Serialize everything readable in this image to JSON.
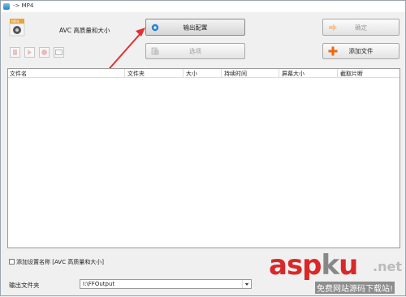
{
  "window": {
    "title": "-> MP4"
  },
  "profile": {
    "label": "AVC 高质量和大小"
  },
  "buttons": {
    "output_config": "输出配置",
    "options": "选项",
    "ok": "确定",
    "add_file": "添加文件"
  },
  "table": {
    "columns": [
      "文件名",
      "文件夹",
      "大小",
      "持续时间",
      "屏幕大小",
      "截取片断"
    ],
    "rows": []
  },
  "add_setting_name": {
    "label": "添加设置名称 [AVC 高质量和大小]",
    "checked": false
  },
  "output_folder": {
    "label": "输出文件夹",
    "value": "I:\\FFOutput"
  },
  "watermark": {
    "brand_a": "asp",
    "brand_k": "k",
    "brand_u": "u",
    "domain": ".net",
    "sub": "免费网站源码下载站!"
  },
  "colors": {
    "annotation_arrow": "#e03030",
    "add_icon": "#e86a10"
  }
}
